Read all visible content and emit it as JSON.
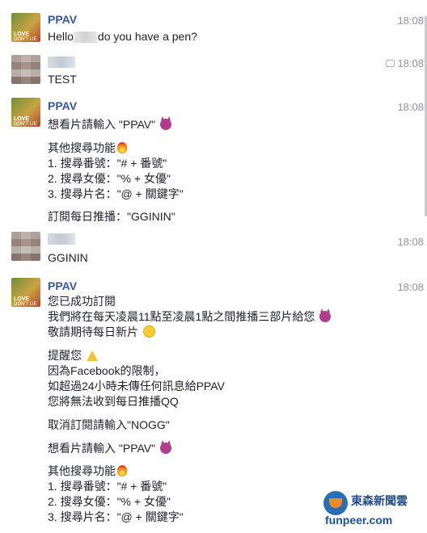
{
  "messages": [
    {
      "sender": "PPAV",
      "time": "18:08",
      "avatar_caption": [
        "LOVE",
        "DON'T LIE"
      ],
      "line_parts": [
        "Hello",
        "do you have a pen?"
      ]
    },
    {
      "sender": "",
      "time": "18:08",
      "lines": [
        "TEST"
      ]
    },
    {
      "sender": "PPAV",
      "time": "18:08",
      "avatar_caption": [
        "LOVE",
        "DON'T LIE"
      ],
      "lines": [
        "想看片請輸入 \"PPAV\"",
        "",
        "其他搜尋功能",
        "1. 搜尋番號：\"# + 番號\"",
        "2. 搜尋女優：\"% + 女優\"",
        "3. 搜尋片名：\"@ + 關鍵字\"",
        "",
        "訂閱每日推播：\"GGININ\""
      ]
    },
    {
      "sender": "",
      "time": "18:08",
      "lines": [
        "GGININ"
      ]
    },
    {
      "sender": "PPAV",
      "time": "18:08",
      "avatar_caption": [
        "LOVE",
        "DON'T LIE"
      ],
      "lines": [
        "您已成功訂閱",
        "我們將在每天凌晨11點至凌晨1點之間推播三部片給您",
        "敬請期待每日新片",
        "",
        "提醒您",
        "因為Facebook的限制，",
        "如超過24小時未傳任何訊息給PPAV",
        "您將無法收到每日推播QQ",
        "",
        "取消訂閱請輸入\"NOGG\"",
        "",
        "想看片請輸入 \"PPAV\"",
        "",
        "其他搜尋功能",
        "1. 搜尋番號：\"# + 番號\"",
        "2. 搜尋女優：\"% + 女優\"",
        "3. 搜尋片名：\"@ + 關鍵字\""
      ]
    }
  ],
  "watermark": {
    "name_cn": "東森新聞雲",
    "site": "funpeer.com"
  },
  "colors": {
    "sender_name": "#365899",
    "timestamp": "#90949c",
    "text": "#1d2129"
  },
  "icons": [
    "devil-emoji",
    "fire-emoji",
    "smile-emoji",
    "warning-emoji",
    "reply-icon"
  ]
}
